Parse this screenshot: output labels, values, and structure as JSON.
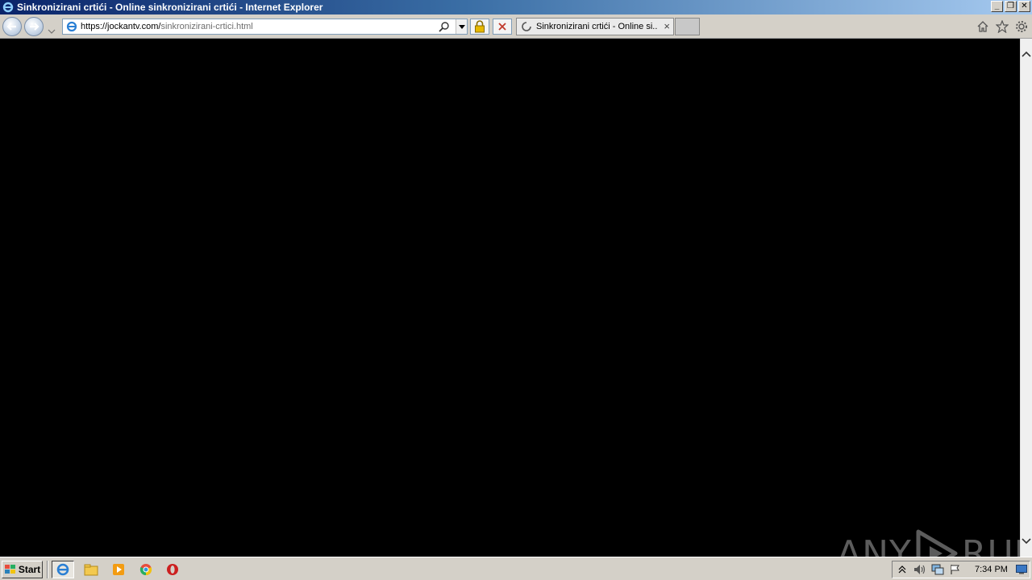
{
  "window": {
    "title": "Sinkronizirani crtići - Online sinkronizirani crtići - Internet Explorer",
    "minimize_label": "_",
    "maximize_label": "❐",
    "close_label": "✕"
  },
  "address": {
    "url_host": "https://jockantv.com/",
    "url_path": "sinkronizirani-crtici.html"
  },
  "tab": {
    "title": "Sinkronizirani crtići - Online si...",
    "close_label": "×"
  },
  "watermark": {
    "left": "ANY",
    "right": "RUN"
  },
  "taskbar": {
    "start_label": "Start",
    "clock": "7:34 PM"
  },
  "icons": {
    "ie": "ie-icon",
    "back": "back-arrow-icon",
    "forward": "forward-arrow-icon",
    "home": "home-icon",
    "favorites": "star-icon",
    "tools": "gear-icon"
  }
}
